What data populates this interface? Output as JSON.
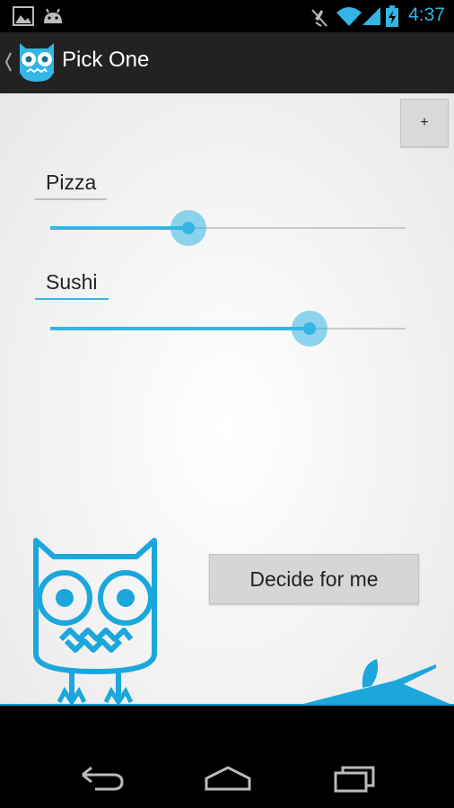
{
  "status_bar": {
    "time": "4:37",
    "icons": [
      "gallery-icon",
      "android-icon",
      "mute-icon",
      "wifi-icon",
      "signal-icon",
      "battery-charging-icon"
    ]
  },
  "action_bar": {
    "title": "Pick One",
    "app_icon": "owl-logo-icon"
  },
  "content": {
    "add_label": "+",
    "options": [
      {
        "label": "Pizza",
        "weight": 0.39
      },
      {
        "label": "Sushi",
        "weight": 0.73
      }
    ],
    "decide_label": "Decide for me"
  },
  "navigation": {
    "buttons": [
      "back-icon",
      "home-icon",
      "recent-apps-icon"
    ]
  },
  "colors": {
    "accent": "#33b5e5",
    "brand_blue": "#0e9bd5",
    "action_bar": "#222222",
    "status_bar": "#000000"
  }
}
